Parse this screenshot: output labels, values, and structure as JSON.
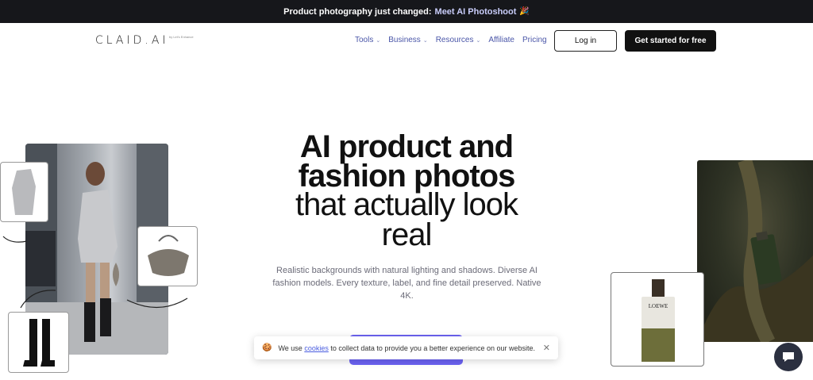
{
  "banner": {
    "text": "Product photography just changed:",
    "link": "Meet AI Photoshoot",
    "emoji": "🎉"
  },
  "nav": {
    "logo": "CLAID.AI",
    "logo_sub": "by Let's Enhance",
    "menu": [
      {
        "label": "Tools",
        "has_dropdown": true
      },
      {
        "label": "Business",
        "has_dropdown": true
      },
      {
        "label": "Resources",
        "has_dropdown": true
      },
      {
        "label": "Affiliate",
        "has_dropdown": false
      },
      {
        "label": "Pricing",
        "has_dropdown": false
      }
    ],
    "login_label": "Log in",
    "cta_label": "Get started for free"
  },
  "hero": {
    "title_line1": "AI product and",
    "title_line2": "fashion photos",
    "title_line3": "that actually look",
    "title_line4": "real",
    "subtitle": "Realistic backgrounds with natural lighting and shadows. Diverse AI fashion models. Every texture, label, and fine detail preserved. Native 4K."
  },
  "cookie": {
    "icon": "cookie-icon",
    "text_before": "We use",
    "link": "cookies",
    "text_after": "to collect data to provide you a better experience on our website."
  },
  "products": {
    "bottle_label": "LOEWE"
  },
  "colors": {
    "banner_bg": "#16171b",
    "accent": "#6c63f3",
    "nav_link": "#4a56a8"
  }
}
